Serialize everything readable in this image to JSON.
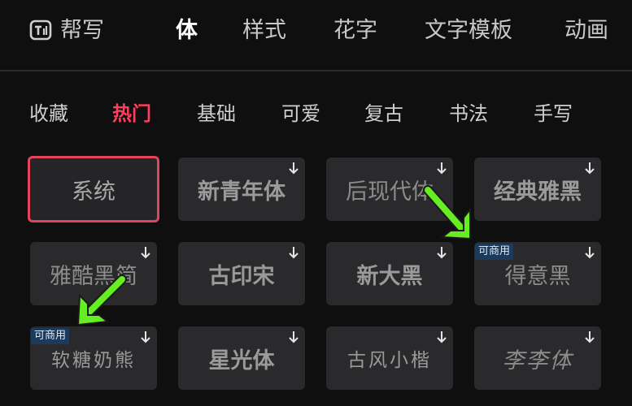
{
  "topbar": {
    "helper": "帮写",
    "tabs": [
      "体",
      "样式",
      "花字",
      "文字模板",
      "动画"
    ],
    "active_tab": "体"
  },
  "categories": {
    "items": [
      "收藏",
      "热门",
      "基础",
      "可爱",
      "复古",
      "书法",
      "手写"
    ],
    "active": "热门"
  },
  "fonts": [
    {
      "label": "系统",
      "selected": true
    },
    {
      "label": "新青年体"
    },
    {
      "label": "后现代体"
    },
    {
      "label": "经典雅黑"
    },
    {
      "label": "雅酷黑简"
    },
    {
      "label": "古印宋"
    },
    {
      "label": "新大黑"
    },
    {
      "label": "得意黑",
      "badge": "可商用"
    },
    {
      "label": "软糖奶熊",
      "badge": "可商用"
    },
    {
      "label": "星光体"
    },
    {
      "label": "古风小楷"
    },
    {
      "label": "李李体"
    }
  ],
  "colors": {
    "accent": "#ff3d5d",
    "selected_border": "#e0455b",
    "annotation_arrow": "#66ee22",
    "badge_bg": "#1c3b5c"
  },
  "icons": {
    "logo": "text-ai-helper-icon",
    "download": "download-arrow-icon",
    "annotation": "green-arrow-pointer"
  }
}
